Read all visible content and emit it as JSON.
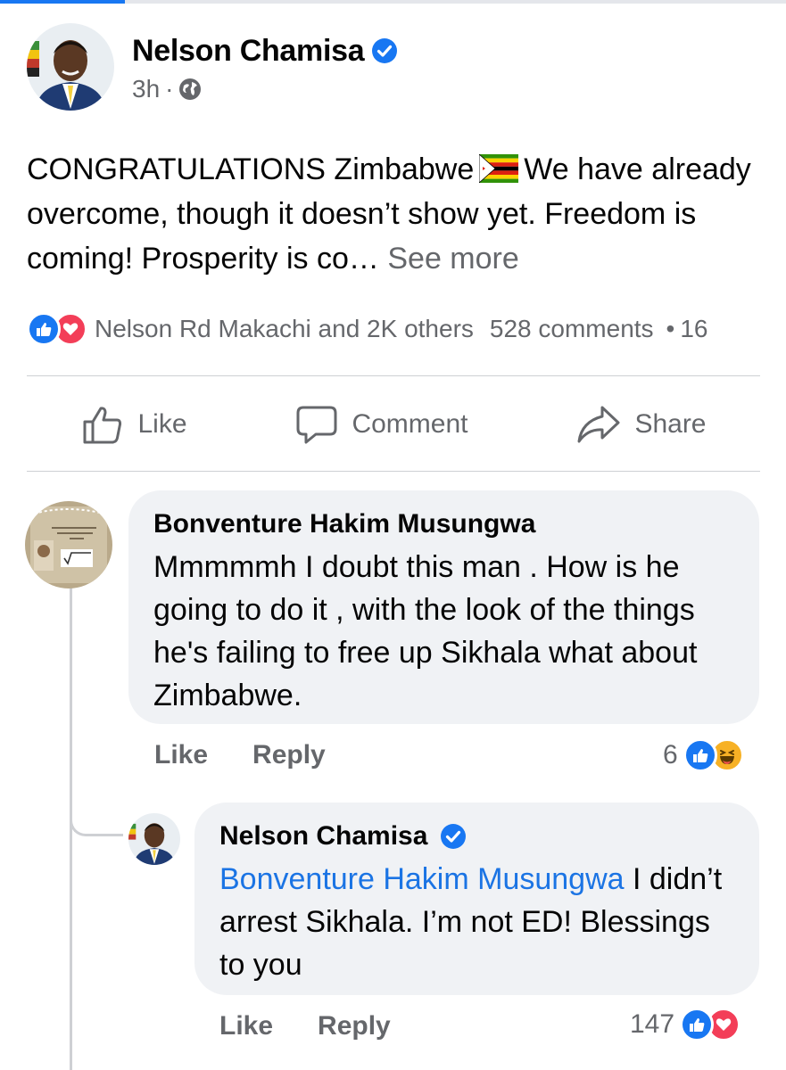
{
  "post": {
    "author": "Nelson Chamisa",
    "time": "3h",
    "meta_sep": "·",
    "text_1": "CONGRATULATIONS Zimbabwe",
    "text_2": "We have already overcome, though it doesn’t show yet. Freedom is coming! Prosperity is co…",
    "see_more": "See more",
    "reactors": "Nelson Rd Makachi and 2K others",
    "comments_count": "528 comments",
    "summary_sep": "•",
    "shares_count": "16"
  },
  "actions": {
    "like": "Like",
    "comment": "Comment",
    "share": "Share"
  },
  "comments": [
    {
      "author": "Bonventure Hakim Musungwa",
      "text": "Mmmmmh I doubt this man . How is he going to do it , with the look of the things he's failing to free up Sikhala what about Zimbabwe.",
      "like": "Like",
      "reply": "Reply",
      "reaction_count": "6"
    },
    {
      "author": "Nelson Chamisa",
      "mention": "Bonventure Hakim Musungwa",
      "text": " I didn’t arrest Sikhala. I’m not ED! Blessings to you",
      "like": "Like",
      "reply": "Reply",
      "reaction_count": "147"
    }
  ],
  "colors": {
    "brand_blue": "#1877f2",
    "love_red": "#f33e58",
    "haha_yellow": "#f7b125",
    "secondary_text": "#65676b",
    "bubble_bg": "#f0f2f5"
  },
  "icons": [
    "verified-badge-icon",
    "globe-icon",
    "like-reaction-icon",
    "love-reaction-icon",
    "haha-reaction-icon",
    "thumbs-up-icon",
    "comment-icon",
    "share-icon",
    "zimbabwe-flag-icon"
  ]
}
